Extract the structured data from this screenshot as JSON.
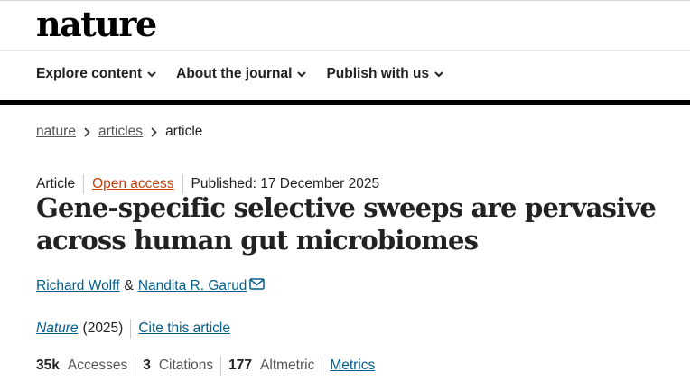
{
  "brand": {
    "logo": "nature"
  },
  "nav": [
    {
      "label": "Explore content"
    },
    {
      "label": "About the journal"
    },
    {
      "label": "Publish with us"
    }
  ],
  "breadcrumb": [
    {
      "label": "nature"
    },
    {
      "label": "articles"
    },
    {
      "label": "article"
    }
  ],
  "article": {
    "type": "Article",
    "access": "Open access",
    "published": "Published: 17 December 2025",
    "title": "Gene-specific selective sweeps are pervasive across human gut microbiomes",
    "authors": [
      "Richard Wolff",
      "Nandita R. Garud"
    ],
    "author_separator": "&",
    "journal": "Nature",
    "year": "(2025)",
    "cite_label": "Cite this article"
  },
  "metrics": {
    "accesses_value": "35k",
    "accesses_label": "Accesses",
    "citations_value": "3",
    "citations_label": "Citations",
    "altmetric_value": "177",
    "altmetric_label": "Altmetric",
    "metrics_link": "Metrics"
  },
  "colors": {
    "link": "#025e8d",
    "open_access": "#c2410c",
    "text": "#222222"
  },
  "icons": [
    "chevron-down-icon",
    "chevron-right-icon",
    "envelope-icon"
  ]
}
